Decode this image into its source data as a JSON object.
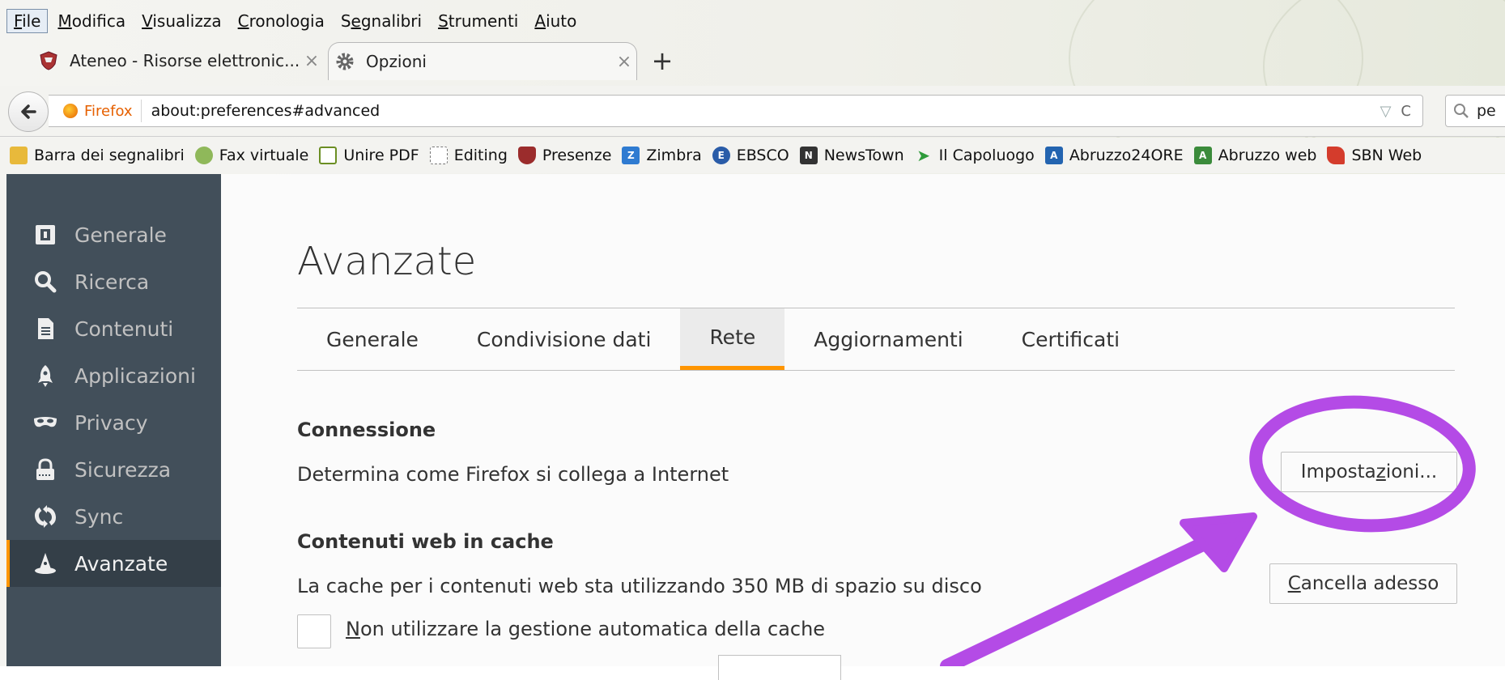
{
  "menubar": {
    "items": [
      {
        "label": "File",
        "accel": "F",
        "rest": "ile"
      },
      {
        "label": "Modifica",
        "accel": "M",
        "rest": "odifica"
      },
      {
        "label": "Visualizza",
        "accel": "V",
        "rest": "isualizza"
      },
      {
        "label": "Cronologia",
        "accel": "C",
        "rest": "ronologia"
      },
      {
        "label": "Segnalibri",
        "pre": "S",
        "accel": "e",
        "rest": "gnalibri"
      },
      {
        "label": "Strumenti",
        "accel": "S",
        "rest": "trumenti"
      },
      {
        "label": "Aiuto",
        "accel": "A",
        "rest": "iuto"
      }
    ]
  },
  "tabs": [
    {
      "title": "Ateneo - Risorse elettronic...",
      "close": "×",
      "icon": "shield-crest-icon"
    },
    {
      "title": "Opzioni",
      "close": "×",
      "icon": "gear-icon",
      "active": true
    }
  ],
  "new_tab_label": "+",
  "navbar": {
    "identity_label": "Firefox",
    "url": "about:preferences#advanced",
    "dropmarker": "▽",
    "reload": "C",
    "search_value": "pe"
  },
  "bookmarks": [
    {
      "label": "Barra dei segnalibri",
      "icon": "folder-icon",
      "color": "#e8b93b"
    },
    {
      "label": "Fax virtuale",
      "icon": "fax-icon",
      "color": "#8fb85a"
    },
    {
      "label": "Unire PDF",
      "icon": "pdf-icon",
      "color": "#6b8e23"
    },
    {
      "label": "Editing",
      "icon": "dashed-page-icon",
      "color": "#ffffff"
    },
    {
      "label": "Presenze",
      "icon": "shield-crest-icon",
      "color": "#9b2c2c"
    },
    {
      "label": "Zimbra",
      "icon": "zimbra-icon",
      "color": "#2f7bd1"
    },
    {
      "label": "EBSCO",
      "icon": "ebsco-icon",
      "color": "#2a5ca8"
    },
    {
      "label": "NewsTown",
      "icon": "newstown-icon",
      "color": "#333333"
    },
    {
      "label": "Il Capoluogo",
      "icon": "capoluogo-icon",
      "color": "#2e9b3a"
    },
    {
      "label": "Abruzzo24ORE",
      "icon": "abruzzo24-icon",
      "color": "#2364b0"
    },
    {
      "label": "Abruzzo web",
      "icon": "abruzzoweb-icon",
      "color": "#3b8b3b"
    },
    {
      "label": "SBN Web",
      "icon": "sbn-icon",
      "color": "#d43c2c"
    }
  ],
  "sidebar": {
    "items": [
      {
        "label": "Generale",
        "icon": "general-icon"
      },
      {
        "label": "Ricerca",
        "icon": "search-icon"
      },
      {
        "label": "Contenuti",
        "icon": "document-icon"
      },
      {
        "label": "Applicazioni",
        "icon": "rocket-icon"
      },
      {
        "label": "Privacy",
        "icon": "mask-icon"
      },
      {
        "label": "Sicurezza",
        "icon": "lock-icon"
      },
      {
        "label": "Sync",
        "icon": "sync-icon"
      },
      {
        "label": "Avanzate",
        "icon": "wizard-hat-icon",
        "selected": true
      }
    ]
  },
  "page": {
    "title": "Avanzate",
    "subtabs": [
      {
        "label": "Generale"
      },
      {
        "label": "Condivisione dati"
      },
      {
        "label": "Rete",
        "selected": true
      },
      {
        "label": "Aggiornamenti"
      },
      {
        "label": "Certificati"
      }
    ],
    "connection": {
      "heading": "Connessione",
      "text": "Determina come Firefox si collega a Internet",
      "button_pre": "Imposta",
      "button_accel": "z",
      "button_post": "ioni..."
    },
    "cache": {
      "heading": "Contenuti web in cache",
      "text": "La cache per i contenuti web sta utilizzando 350 MB di spazio su disco",
      "button_accel": "C",
      "button_post": "ancella adesso",
      "checkbox_accel": "N",
      "checkbox_post": "on utilizzare la gestione automatica della cache",
      "checkbox_checked": false
    }
  },
  "colors": {
    "accent": "#ff9500",
    "annotation": "#b44be6",
    "sidebar_bg": "#424f5a",
    "sidebar_selected_bg": "#343f48"
  }
}
